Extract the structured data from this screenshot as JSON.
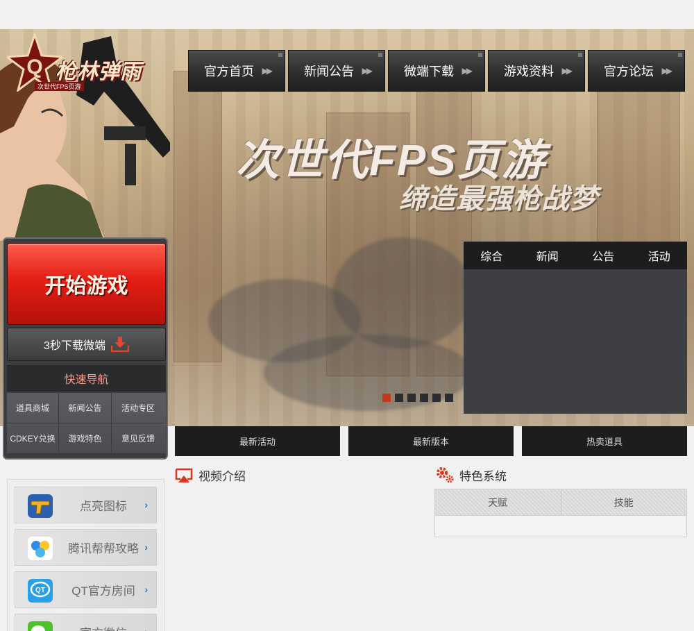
{
  "logo": {
    "title": "枪林弹雨",
    "subtitle": "次世代FPS页游"
  },
  "nav": {
    "items": [
      {
        "label": "官方首页"
      },
      {
        "label": "新闻公告"
      },
      {
        "label": "微端下载"
      },
      {
        "label": "游戏资料"
      },
      {
        "label": "官方论坛"
      }
    ],
    "arrow_glyph": "▶▶"
  },
  "banner": {
    "slogan_line1": "次世代FPS页游",
    "slogan_line2": "缔造最强枪战梦"
  },
  "start_panel": {
    "start_label": "开始游戏",
    "download_label": "3秒下载微端",
    "quick_nav_title": "快速导航",
    "quick_nav_items": [
      {
        "label": "道具商城"
      },
      {
        "label": "新闻公告"
      },
      {
        "label": "活动专区"
      },
      {
        "label": "CDKEY兑换"
      },
      {
        "label": "游戏特色"
      },
      {
        "label": "意见反馈"
      }
    ]
  },
  "news": {
    "tabs": [
      {
        "label": "综合"
      },
      {
        "label": "新闻"
      },
      {
        "label": "公告"
      },
      {
        "label": "活动"
      }
    ]
  },
  "slider": {
    "count": 6,
    "active_index": 0
  },
  "mid_buttons": [
    {
      "label": "最新活动"
    },
    {
      "label": "最新版本"
    },
    {
      "label": "热卖道具"
    }
  ],
  "links": [
    {
      "label": "点亮图标",
      "icon": "golden-gun-icon"
    },
    {
      "label": "腾讯帮帮攻略",
      "icon": "bangbang-icon"
    },
    {
      "label": "QT官方房间",
      "icon": "qt-icon"
    },
    {
      "label": "官方微信",
      "icon": "wechat-icon"
    }
  ],
  "video": {
    "title": "视频介绍"
  },
  "feature": {
    "title": "特色系统",
    "tabs": [
      {
        "label": "天赋"
      },
      {
        "label": "技能"
      }
    ]
  },
  "colors": {
    "accent_red": "#e31e14",
    "dark_panel": "#3d3f42",
    "slider_active": "#c3391f",
    "link_chevron": "#1f77c8"
  }
}
